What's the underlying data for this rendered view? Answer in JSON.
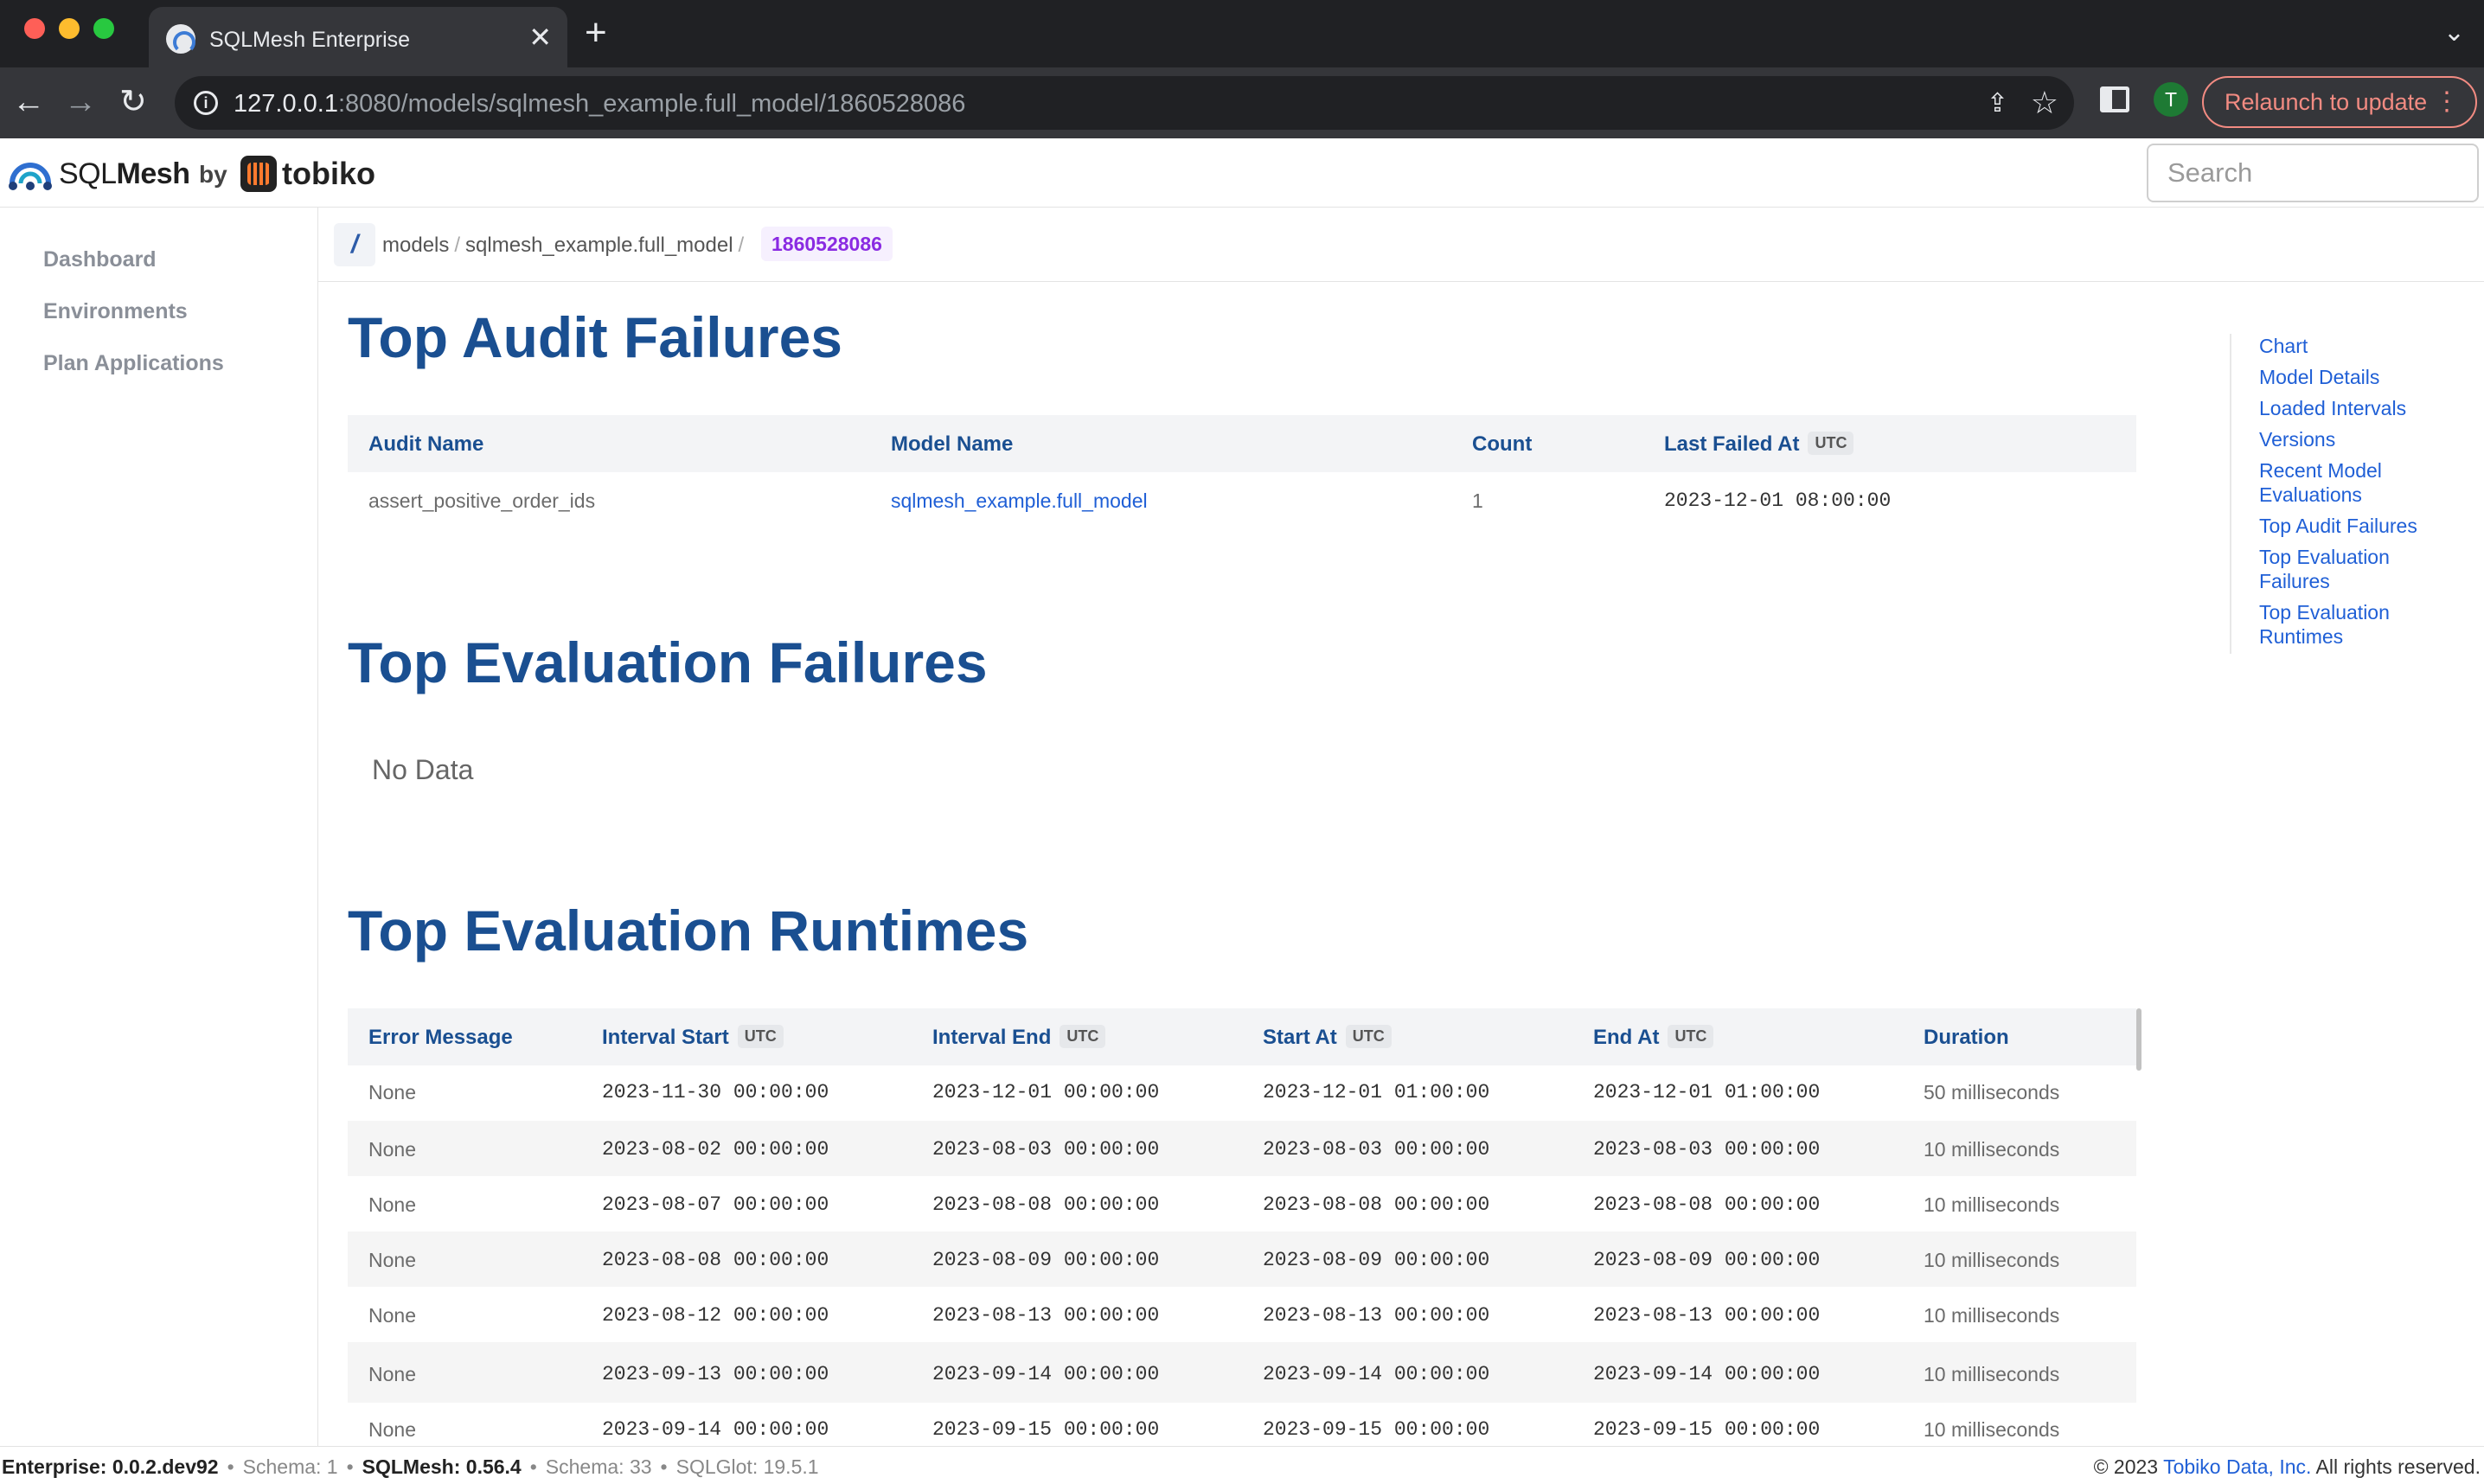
{
  "browser": {
    "tab_title": "SQLMesh Enterprise",
    "url_host": "127.0.0.1",
    "url_rest": ":8080/models/sqlmesh_example.full_model/1860528086",
    "profile_initial": "T",
    "relaunch_label": "Relaunch to update"
  },
  "header": {
    "brand_sql": "SQL",
    "brand_mesh": "Mesh",
    "by": "by",
    "company": "tobiko",
    "search_placeholder": "Search"
  },
  "sidebar": {
    "items": [
      {
        "label": "Dashboard"
      },
      {
        "label": "Environments"
      },
      {
        "label": "Plan Applications"
      }
    ]
  },
  "breadcrumb": {
    "root": "/",
    "items": [
      "models",
      "sqlmesh_example.full_model"
    ],
    "current": "1860528086"
  },
  "audit": {
    "title": "Top Audit Failures",
    "columns": [
      "Audit Name",
      "Model Name",
      "Count",
      "Last Failed At"
    ],
    "utc": "UTC",
    "rows": [
      {
        "audit_name": "assert_positive_order_ids",
        "model_name": "sqlmesh_example.full_model",
        "count": "1",
        "last_failed_at": "2023-12-01 08:00:00"
      }
    ]
  },
  "evaluation_failures": {
    "title": "Top Evaluation Failures",
    "empty": "No Data"
  },
  "runtimes": {
    "title": "Top Evaluation Runtimes",
    "columns": [
      "Error Message",
      "Interval Start",
      "Interval End",
      "Start At",
      "End At",
      "Duration"
    ],
    "utc": "UTC",
    "rows": [
      {
        "error": "None",
        "interval_start": "2023-11-30 00:00:00",
        "interval_end": "2023-12-01 00:00:00",
        "start_at": "2023-12-01 01:00:00",
        "end_at": "2023-12-01 01:00:00",
        "duration": "50 milliseconds"
      },
      {
        "error": "None",
        "interval_start": "2023-08-02 00:00:00",
        "interval_end": "2023-08-03 00:00:00",
        "start_at": "2023-08-03 00:00:00",
        "end_at": "2023-08-03 00:00:00",
        "duration": "10 milliseconds"
      },
      {
        "error": "None",
        "interval_start": "2023-08-07 00:00:00",
        "interval_end": "2023-08-08 00:00:00",
        "start_at": "2023-08-08 00:00:00",
        "end_at": "2023-08-08 00:00:00",
        "duration": "10 milliseconds"
      },
      {
        "error": "None",
        "interval_start": "2023-08-08 00:00:00",
        "interval_end": "2023-08-09 00:00:00",
        "start_at": "2023-08-09 00:00:00",
        "end_at": "2023-08-09 00:00:00",
        "duration": "10 milliseconds"
      },
      {
        "error": "None",
        "interval_start": "2023-08-12 00:00:00",
        "interval_end": "2023-08-13 00:00:00",
        "start_at": "2023-08-13 00:00:00",
        "end_at": "2023-08-13 00:00:00",
        "duration": "10 milliseconds"
      },
      {
        "error": "None",
        "interval_start": "2023-09-13 00:00:00",
        "interval_end": "2023-09-14 00:00:00",
        "start_at": "2023-09-14 00:00:00",
        "end_at": "2023-09-14 00:00:00",
        "duration": "10 milliseconds"
      },
      {
        "error": "None",
        "interval_start": "2023-09-14 00:00:00",
        "interval_end": "2023-09-15 00:00:00",
        "start_at": "2023-09-15 00:00:00",
        "end_at": "2023-09-15 00:00:00",
        "duration": "10 milliseconds"
      }
    ]
  },
  "toc": {
    "items": [
      "Chart",
      "Model Details",
      "Loaded Intervals",
      "Versions",
      "Recent Model Evaluations",
      "Top Audit Failures",
      "Top Evaluation Failures",
      "Top Evaluation Runtimes"
    ]
  },
  "footer": {
    "enterprise": "Enterprise: 0.0.2.dev92",
    "enterprise_schema": "Schema: 1",
    "sqlmesh": "SQLMesh: 0.56.4",
    "sqlmesh_schema": "Schema: 33",
    "sqlglot": "SQLGlot: 19.5.1",
    "sep": "•",
    "copyright": "© 2023",
    "company_link": "Tobiko Data, Inc.",
    "rights": "All rights reserved."
  }
}
